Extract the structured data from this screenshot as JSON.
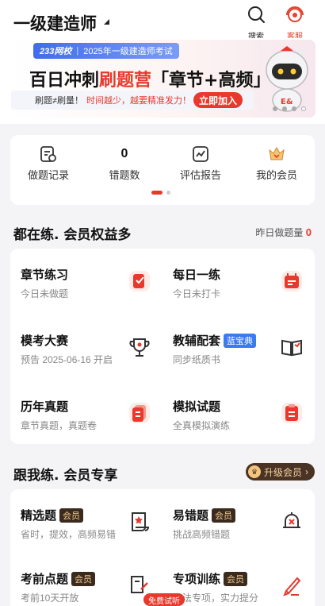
{
  "header": {
    "title": "一级建造师",
    "search_label": "搜索",
    "service_label": "客服"
  },
  "banner": {
    "brand": "233网校",
    "brand_sub": "2025年一级建造师考试",
    "headline_a": "百日冲刺",
    "headline_b": "刷题营",
    "headline_c": "「章节+高频」",
    "strip_text": "刷题≠刷量！",
    "strip_highlight": "时间越少，越要精准发力！",
    "join_label": "立即加入"
  },
  "stats": [
    {
      "label": "做题记录",
      "icon": "practice-record-icon"
    },
    {
      "label": "错题数",
      "value": "0"
    },
    {
      "label": "评估报告",
      "icon": "report-chart-icon"
    },
    {
      "label": "我的会员",
      "icon": "member-crown-icon"
    }
  ],
  "section1": {
    "title": "都在练. 会员权益多",
    "right_label": "昨日做题量",
    "right_value": "0"
  },
  "grid1": [
    {
      "title": "章节练习",
      "sub": "今日未做题",
      "icon": "chapter-practice-icon"
    },
    {
      "title": "每日一练",
      "sub": "今日未打卡",
      "icon": "daily-practice-icon"
    },
    {
      "title": "模考大赛",
      "sub": "预告 2025-06-16 开启",
      "icon": "trophy-icon"
    },
    {
      "title": "教辅配套",
      "badge": "蓝宝典",
      "sub": "同步纸质书",
      "icon": "open-book-icon"
    },
    {
      "title": "历年真题",
      "sub": "章节真题，真题卷",
      "icon": "past-papers-icon"
    },
    {
      "title": "模拟试题",
      "sub": "全真模拟演练",
      "icon": "mock-exam-icon"
    }
  ],
  "section2": {
    "title": "跟我练. 会员专享",
    "upgrade_label": "升级会员"
  },
  "grid2": [
    {
      "title": "精选题",
      "badge": "会员",
      "sub": "省时，提效，高频易错",
      "icon": "selected-questions-icon"
    },
    {
      "title": "易错题",
      "badge": "会员",
      "sub": "挑战高频错题",
      "icon": "error-bell-icon"
    },
    {
      "title": "考前点题",
      "badge": "会员",
      "sub": "考前10天开放",
      "icon": "exam-tips-icon"
    },
    {
      "title": "专项训练",
      "badge": "会员",
      "sub": "方法专项，实力提分",
      "icon": "pen-icon"
    }
  ],
  "trial_label": "免费试听",
  "colors": {
    "accent": "#e8392c",
    "background": "#f4f4f6"
  }
}
